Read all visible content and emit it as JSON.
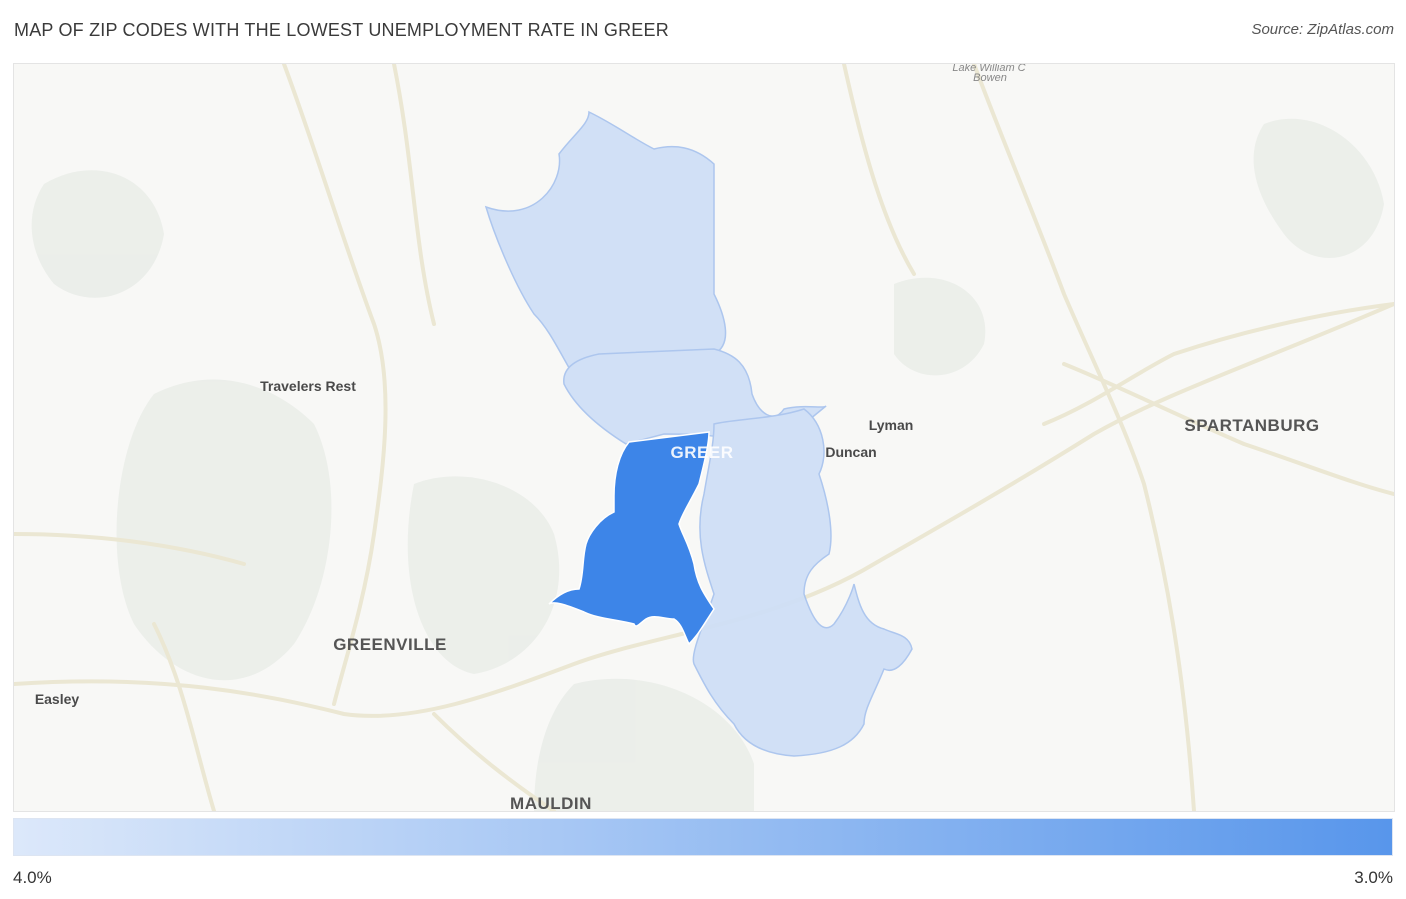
{
  "title": "MAP OF ZIP CODES WITH THE LOWEST UNEMPLOYMENT RATE IN GREER",
  "source": "Source: ZipAtlas.com",
  "map": {
    "place_labels": {
      "travelers_rest": "Travelers Rest",
      "greer": "GREER",
      "lyman": "Lyman",
      "duncan": "Duncan",
      "spartanburg": "SPARTANBURG",
      "greenville": "GREENVILLE",
      "easley": "Easley",
      "mauldin": "MAULDIN",
      "lake": "Lake William C",
      "bowen": "Bowen"
    },
    "colors": {
      "highlight_zip": "#3d85e8",
      "other_zip": "#cfdff6",
      "zip_border": "#a9c4ee",
      "road": "#ebe8d6",
      "land": "#f8f8f6",
      "terrain": "#e9ece8"
    }
  },
  "legend": {
    "min_label": "4.0%",
    "max_label": "3.0%",
    "color_low": "#dce8fa",
    "color_high": "#5896eb"
  }
}
